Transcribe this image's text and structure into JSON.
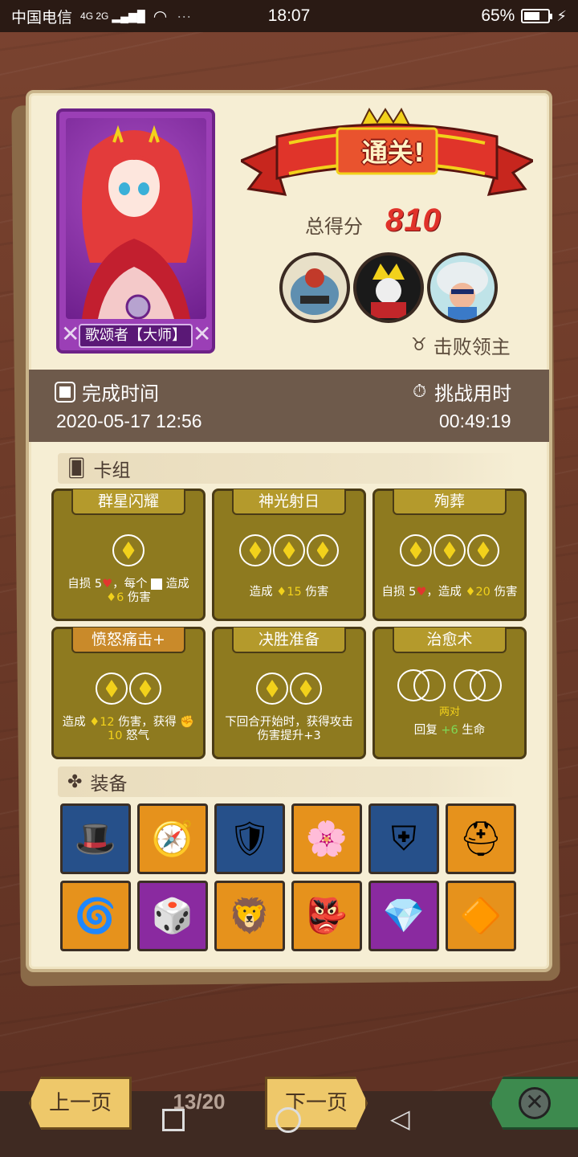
{
  "status_bar": {
    "carrier": "中国电信",
    "network": "4G 2G",
    "time": "18:07",
    "battery_percent_text": "65%",
    "battery_level": 0.65
  },
  "hero": {
    "name": "歌颂者【大师】"
  },
  "result": {
    "banner": "通关!",
    "score_label": "总得分",
    "score_value": "810",
    "defeated_label": "击败领主",
    "bosses": [
      "boss-1",
      "boss-2",
      "boss-3"
    ]
  },
  "times": {
    "completion_label": "完成时间",
    "completion_value": "2020-05-17 12:56",
    "challenge_label": "挑战用时",
    "challenge_value": "00:49:19"
  },
  "deck": {
    "label": "卡组",
    "cards": [
      {
        "title": "群星闪耀",
        "slots": 1,
        "desc_parts": [
          "自损 5",
          "，每个",
          "造成",
          "6",
          "伤害"
        ]
      },
      {
        "title": "神光射日",
        "slots": 3,
        "desc_parts": [
          "造成",
          "15",
          "伤害"
        ]
      },
      {
        "title": "殉葬",
        "slots": 3,
        "desc_parts": [
          "自损 5",
          "，造成",
          "20",
          "伤害"
        ]
      },
      {
        "title": "愤怒痛击+",
        "slots": 2,
        "desc_parts": [
          "造成",
          "12",
          "伤害，获得",
          "10",
          "怒气"
        ]
      },
      {
        "title": "决胜准备",
        "slots": 2,
        "desc_parts": [
          "下回合开始时，获得攻击伤害提升+3"
        ]
      },
      {
        "title": "治愈术",
        "slots": 2,
        "pair_label": "两对",
        "desc_parts": [
          "回复",
          "+6",
          "生命"
        ]
      }
    ]
  },
  "equipment": {
    "label": "装备",
    "items": [
      {
        "icon": "top-hat-icon",
        "color": "#26508a"
      },
      {
        "icon": "golden-compass-icon",
        "color": "#e6921c"
      },
      {
        "icon": "gem-shield-icon",
        "color": "#26508a"
      },
      {
        "icon": "pink-flower-icon",
        "color": "#e6921c"
      },
      {
        "icon": "steel-shield-icon",
        "color": "#26508a"
      },
      {
        "icon": "golden-helmet-icon",
        "color": "#e6921c"
      },
      {
        "icon": "rainbow-swirl-icon",
        "color": "#e6921c"
      },
      {
        "icon": "spiked-dice-icon",
        "color": "#8a2aa0"
      },
      {
        "icon": "lion-ring-icon",
        "color": "#e6921c"
      },
      {
        "icon": "demon-mask-icon",
        "color": "#e6921c"
      },
      {
        "icon": "blue-crystal-icon",
        "color": "#8a2aa0"
      },
      {
        "icon": "yellow-gem-icon",
        "color": "#e6921c"
      }
    ]
  },
  "navigation": {
    "prev_label": "上一页",
    "page_indicator": "13/20",
    "next_label": "下一页"
  }
}
